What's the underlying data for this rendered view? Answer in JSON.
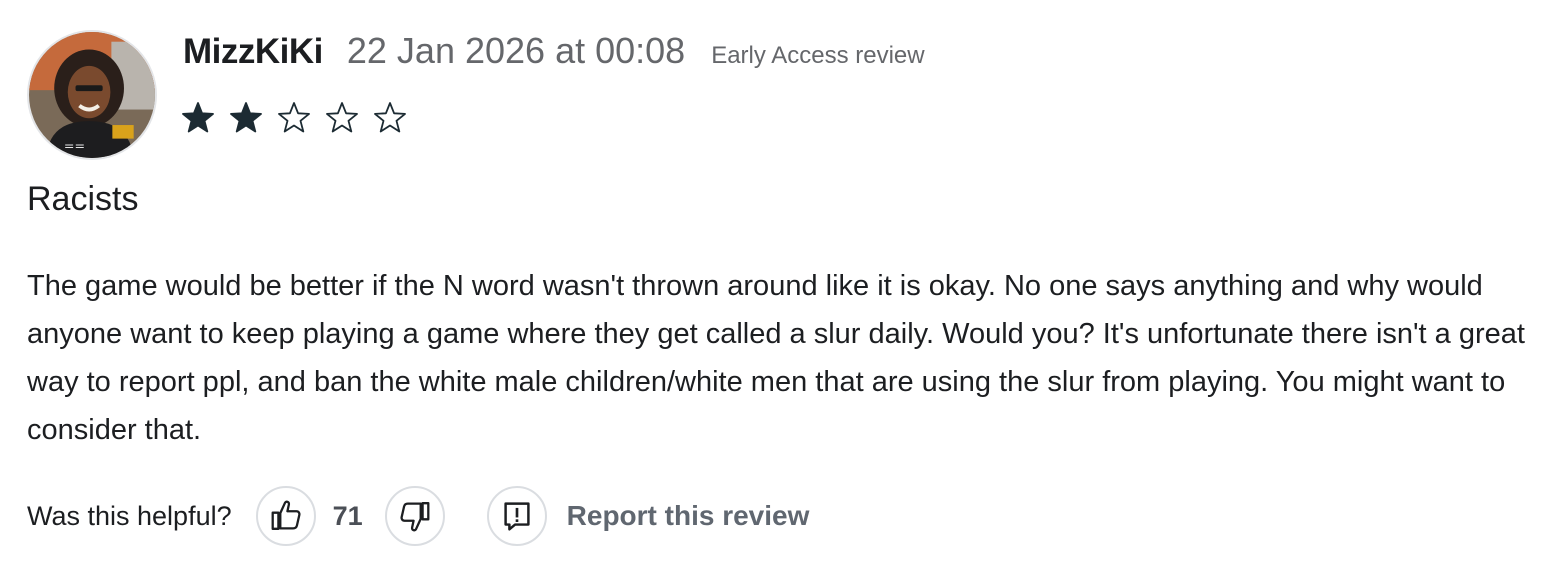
{
  "review": {
    "username": "MizzKiKi",
    "date": "22 Jan 2026 at 00:08",
    "badge": "Early Access review",
    "rating": 2,
    "rating_max": 5,
    "title": "Racists",
    "body": "The game would be better if the N word wasn't thrown around like it is okay. No one says anything and why would anyone want to keep playing a game where they get called a slur daily. Would you? It's unfortunate there isn't a great way to report ppl, and ban the white male children/white men that are using the slur from playing. You might want to consider that."
  },
  "footer": {
    "helpful_label": "Was this helpful?",
    "helpful_count": "71",
    "report_label": "Report this review"
  },
  "icons": {
    "thumbs_up": "thumbs-up-icon",
    "thumbs_down": "thumbs-down-icon",
    "report": "report-flag-icon",
    "star_filled": "star-filled-icon",
    "star_empty": "star-outline-icon"
  },
  "colors": {
    "text": "#1c1e21",
    "muted": "#65676b",
    "star": "#1c2b33",
    "button_border": "#dadde1"
  }
}
